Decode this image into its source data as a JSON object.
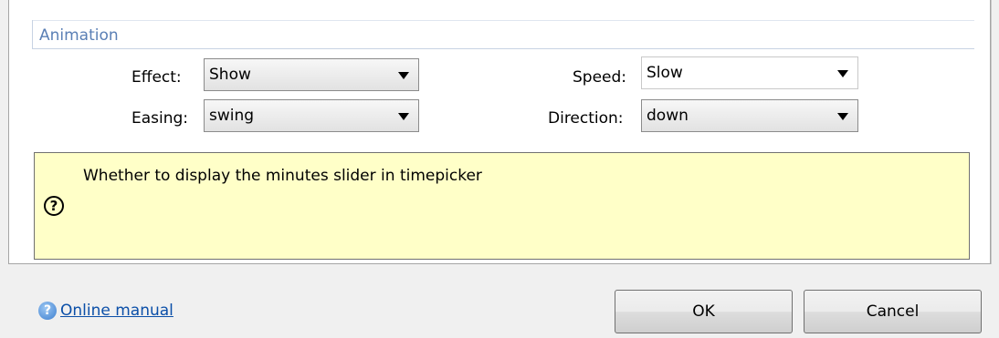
{
  "group": {
    "title": "Animation"
  },
  "fields": {
    "effect": {
      "label": "Effect:",
      "value": "Show"
    },
    "easing": {
      "label": "Easing:",
      "value": "swing"
    },
    "speed": {
      "label": "Speed:",
      "value": "Slow"
    },
    "direction": {
      "label": "Direction:",
      "value": "down"
    }
  },
  "help": {
    "text": "Whether to display the minutes slider in timepicker",
    "icon": "question-circle-icon"
  },
  "footer": {
    "manual_icon": "help-icon",
    "manual_label": "Online manual",
    "ok_label": "OK",
    "cancel_label": "Cancel"
  }
}
